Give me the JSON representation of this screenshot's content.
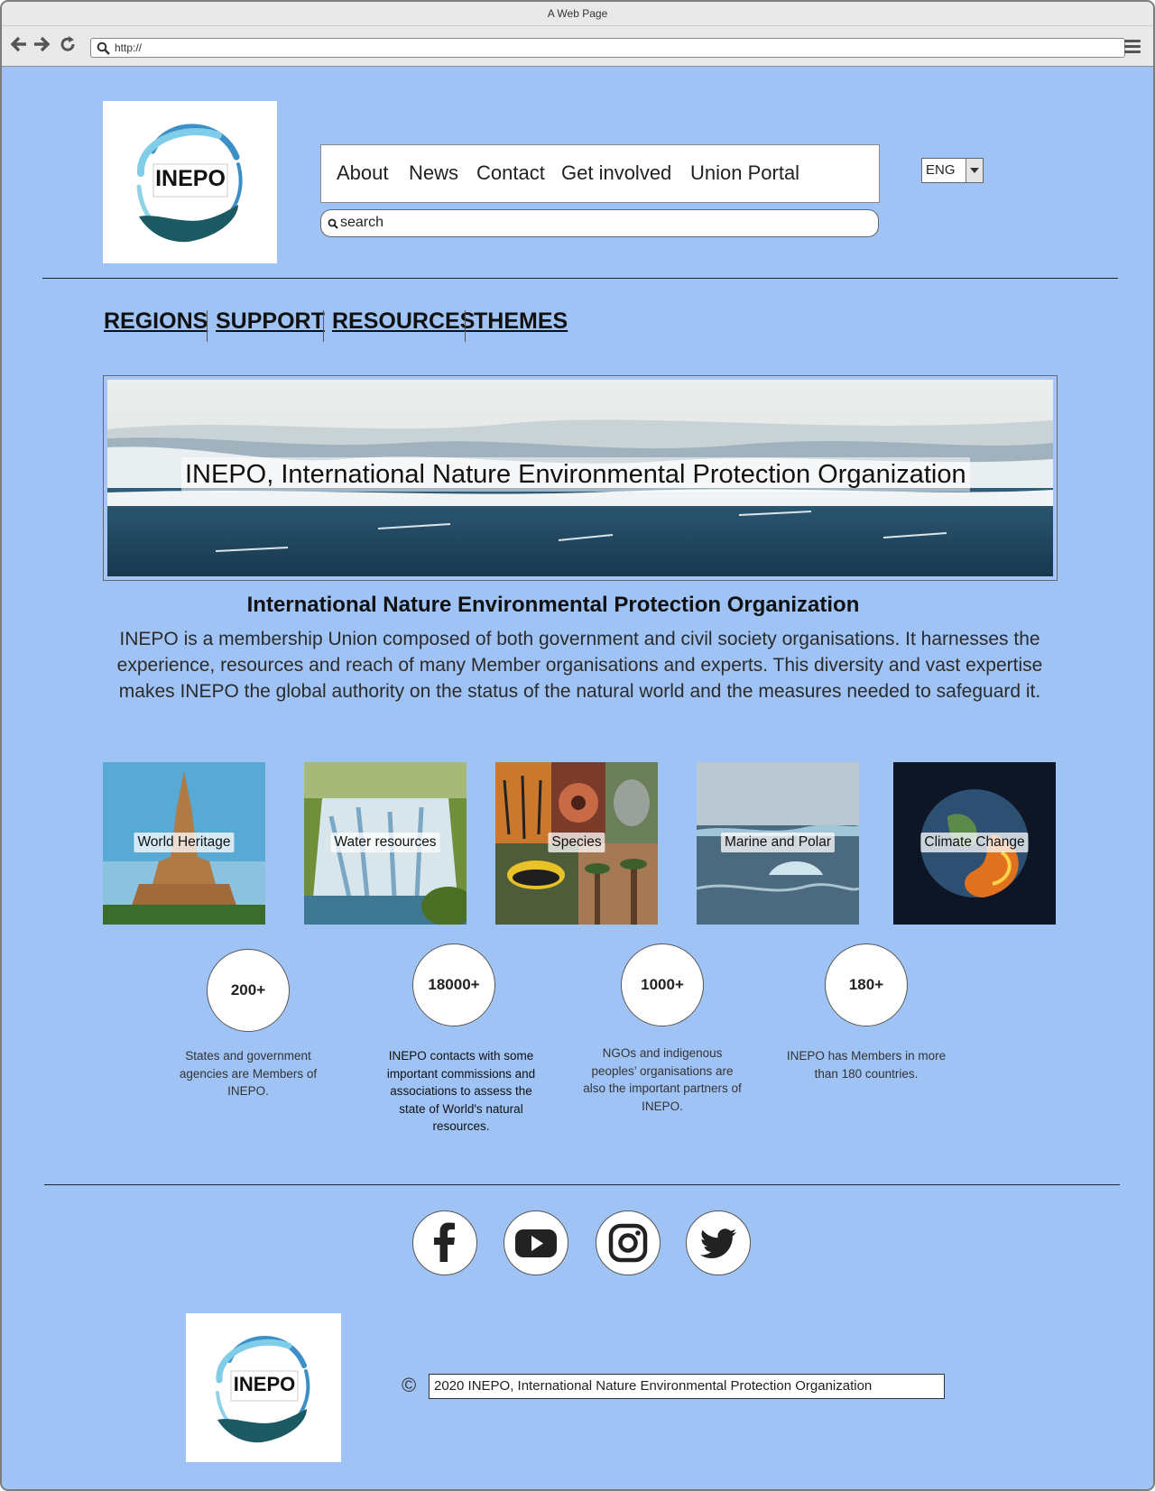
{
  "window": {
    "title": "A Web Page",
    "url": "http://"
  },
  "logo": {
    "text": "INEPO"
  },
  "main_nav": [
    {
      "label": "About"
    },
    {
      "label": "News"
    },
    {
      "label": "Contact"
    },
    {
      "label": "Get involved"
    },
    {
      "label": "Union Portal"
    }
  ],
  "search": {
    "placeholder": "search"
  },
  "language": {
    "selected": "ENG"
  },
  "section_nav": [
    {
      "label": "REGIONS"
    },
    {
      "label": "SUPPORT"
    },
    {
      "label": "RESOURCES"
    },
    {
      "label": "THEMES"
    }
  ],
  "banner": {
    "caption": "INEPO, International Nature Environmental Protection Organization"
  },
  "intro": {
    "heading": "International Nature Environmental Protection Organization",
    "body": "INEPO is a membership Union composed of both government and civil society organisations. It harnesses the experience, resources and reach of many Member organisations and experts. This diversity and vast expertise makes INEPO the global authority on the status of the natural world and the measures needed to safeguard it."
  },
  "themes": [
    {
      "label": "World Heritage"
    },
    {
      "label": "Water resources"
    },
    {
      "label": "Species"
    },
    {
      "label": "Marine and Polar"
    },
    {
      "label": "Climate Change"
    }
  ],
  "stats": [
    {
      "value": "200+",
      "text": "States and government agencies are Members of INEPO."
    },
    {
      "value": "18000+",
      "text": "INEPO contacts with some important commissions and associations to assess the state of World's natural resources."
    },
    {
      "value": "1000+",
      "text": "NGOs and indigenous peoples’ organisations are also the important partners of INEPO."
    },
    {
      "value": "180+",
      "text": "INEPO has Members in more than 180 countries."
    }
  ],
  "social": [
    {
      "icon": "facebook-icon"
    },
    {
      "icon": "youtube-icon"
    },
    {
      "icon": "instagram-icon"
    },
    {
      "icon": "twitter-icon"
    }
  ],
  "footer": {
    "copyright_symbol": "©",
    "copyright_text": "2020 INEPO, International Nature Environmental Protection Organization"
  }
}
